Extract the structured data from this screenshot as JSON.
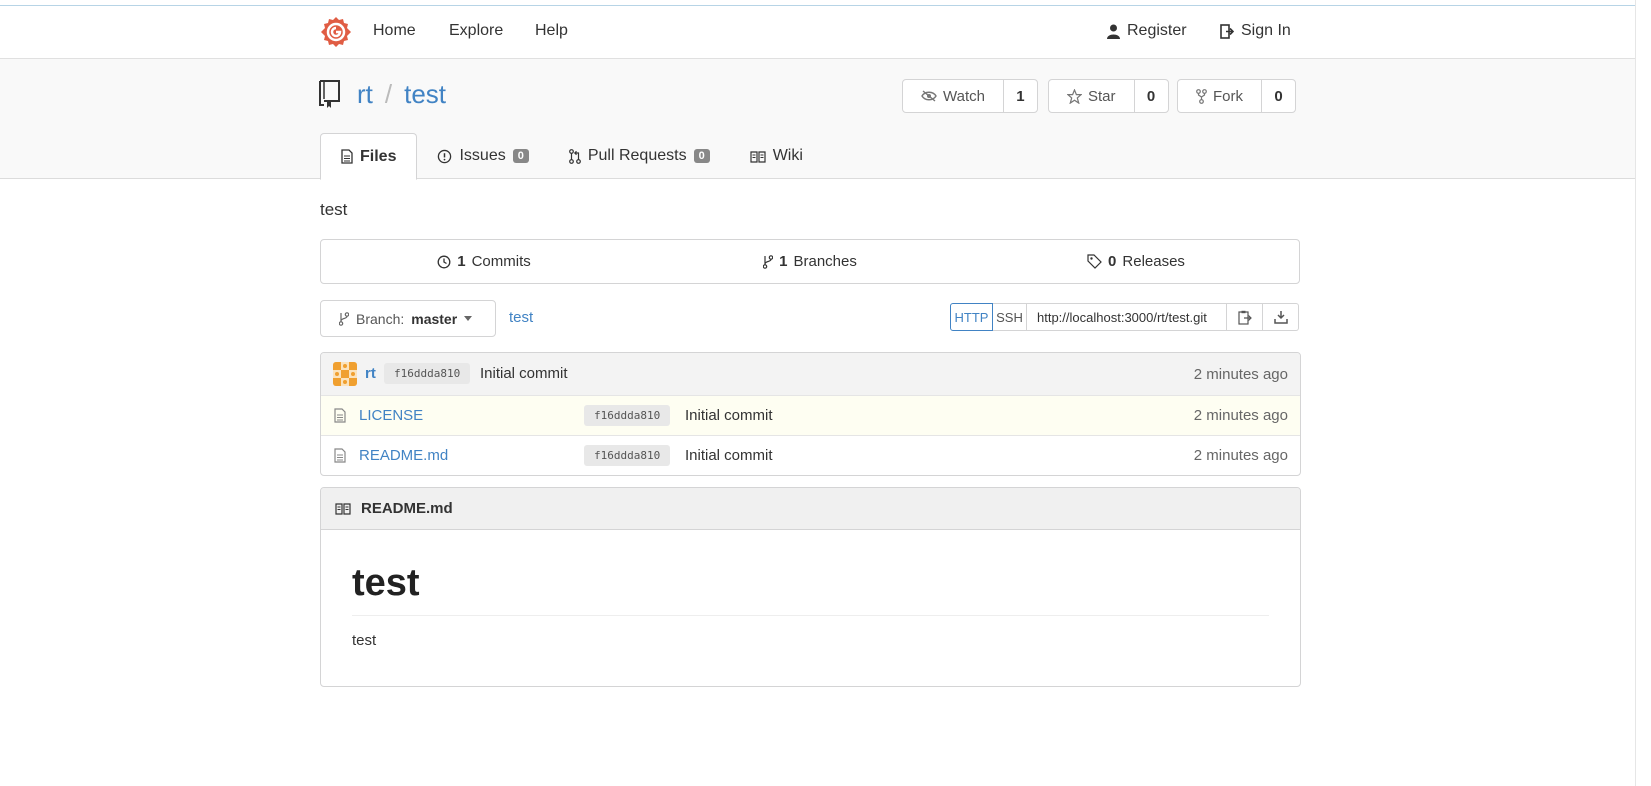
{
  "nav": {
    "home": "Home",
    "explore": "Explore",
    "help": "Help",
    "register": "Register",
    "sign_in": "Sign In"
  },
  "repo": {
    "owner": "rt",
    "separator": "/",
    "name": "test",
    "description": "test"
  },
  "actions": {
    "watch_label": "Watch",
    "watch_count": "1",
    "star_label": "Star",
    "star_count": "0",
    "fork_label": "Fork",
    "fork_count": "0"
  },
  "tabs": [
    {
      "label": "Files",
      "active": true
    },
    {
      "label": "Issues",
      "badge": "0"
    },
    {
      "label": "Pull Requests",
      "badge": "0"
    },
    {
      "label": "Wiki"
    }
  ],
  "stats": {
    "commits_count": "1",
    "commits_label": "Commits",
    "branches_count": "1",
    "branches_label": "Branches",
    "releases_count": "0",
    "releases_label": "Releases"
  },
  "branch": {
    "prefix": "Branch:",
    "name": "master",
    "crumb": "test"
  },
  "clone": {
    "http": "HTTP",
    "ssh": "SSH",
    "url": "http://localhost:3000/rt/test.git"
  },
  "latest_commit": {
    "author": "rt",
    "sha": "f16ddda810",
    "message": "Initial commit",
    "time": "2 minutes ago"
  },
  "files": [
    {
      "name": "LICENSE",
      "sha": "f16ddda810",
      "message": "Initial commit",
      "time": "2 minutes ago"
    },
    {
      "name": "README.md",
      "sha": "f16ddda810",
      "message": "Initial commit",
      "time": "2 minutes ago"
    }
  ],
  "readme": {
    "filename": "README.md",
    "heading": "test",
    "body": "test"
  },
  "colors": {
    "link": "#4183c4",
    "logo": "#e05d44",
    "highlight_row": "#fefef2"
  }
}
